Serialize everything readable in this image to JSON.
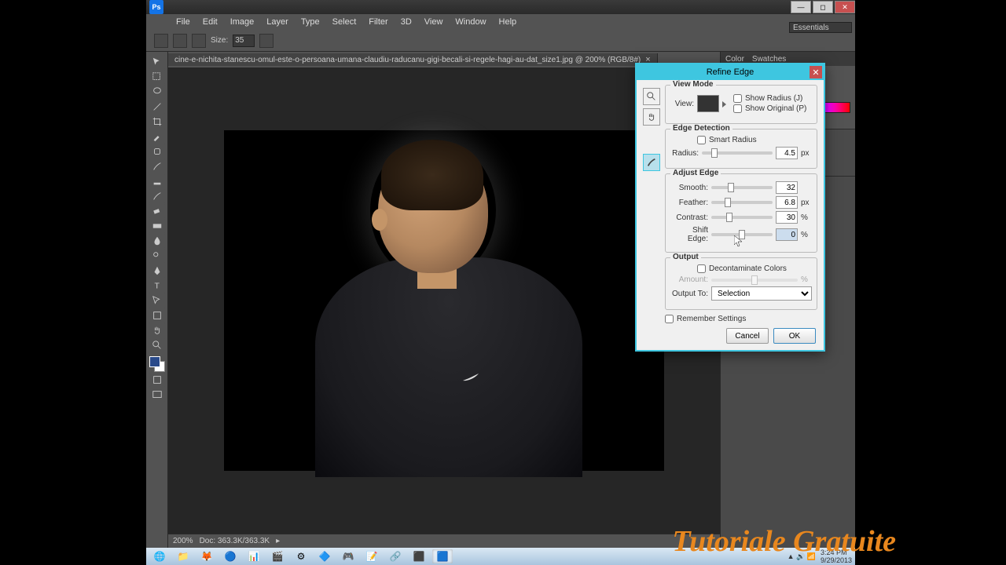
{
  "app": {
    "name": "Ps"
  },
  "menu": {
    "items": [
      "File",
      "Edit",
      "Image",
      "Layer",
      "Type",
      "Select",
      "Filter",
      "3D",
      "View",
      "Window",
      "Help"
    ]
  },
  "options": {
    "size_label": "Size:",
    "size_value": "35"
  },
  "workspace": "Essentials",
  "doc": {
    "tab": "cine-e-nichita-stanescu-omul-este-o-persoana-umana-claudiu-raducanu-gigi-becali-si-regele-hagi-au-dat_size1.jpg @ 200% (RGB/8#)"
  },
  "status": {
    "zoom": "200%",
    "info": "Doc: 363.3K/363.3K"
  },
  "panels": {
    "color": "Color",
    "swatches": "Swatches"
  },
  "dialog": {
    "title": "Refine Edge",
    "view_mode": {
      "legend": "View Mode",
      "view_label": "View:",
      "show_radius": "Show Radius (J)",
      "show_original": "Show Original (P)"
    },
    "edge_detection": {
      "legend": "Edge Detection",
      "smart_radius": "Smart Radius",
      "radius_label": "Radius:",
      "radius_value": "4.5",
      "radius_unit": "px"
    },
    "adjust_edge": {
      "legend": "Adjust Edge",
      "smooth_label": "Smooth:",
      "smooth_value": "32",
      "feather_label": "Feather:",
      "feather_value": "6.8",
      "feather_unit": "px",
      "contrast_label": "Contrast:",
      "contrast_value": "30",
      "contrast_unit": "%",
      "shift_label": "Shift Edge:",
      "shift_value": "0",
      "shift_unit": "%"
    },
    "output": {
      "legend": "Output",
      "decontaminate": "Decontaminate Colors",
      "amount_label": "Amount:",
      "output_to_label": "Output To:",
      "output_to_value": "Selection"
    },
    "remember": "Remember Settings",
    "cancel": "Cancel",
    "ok": "OK"
  },
  "watermark": "Tutoriale Gratuite",
  "tray": {
    "time": "3:24 PM",
    "date": "9/29/2013"
  }
}
